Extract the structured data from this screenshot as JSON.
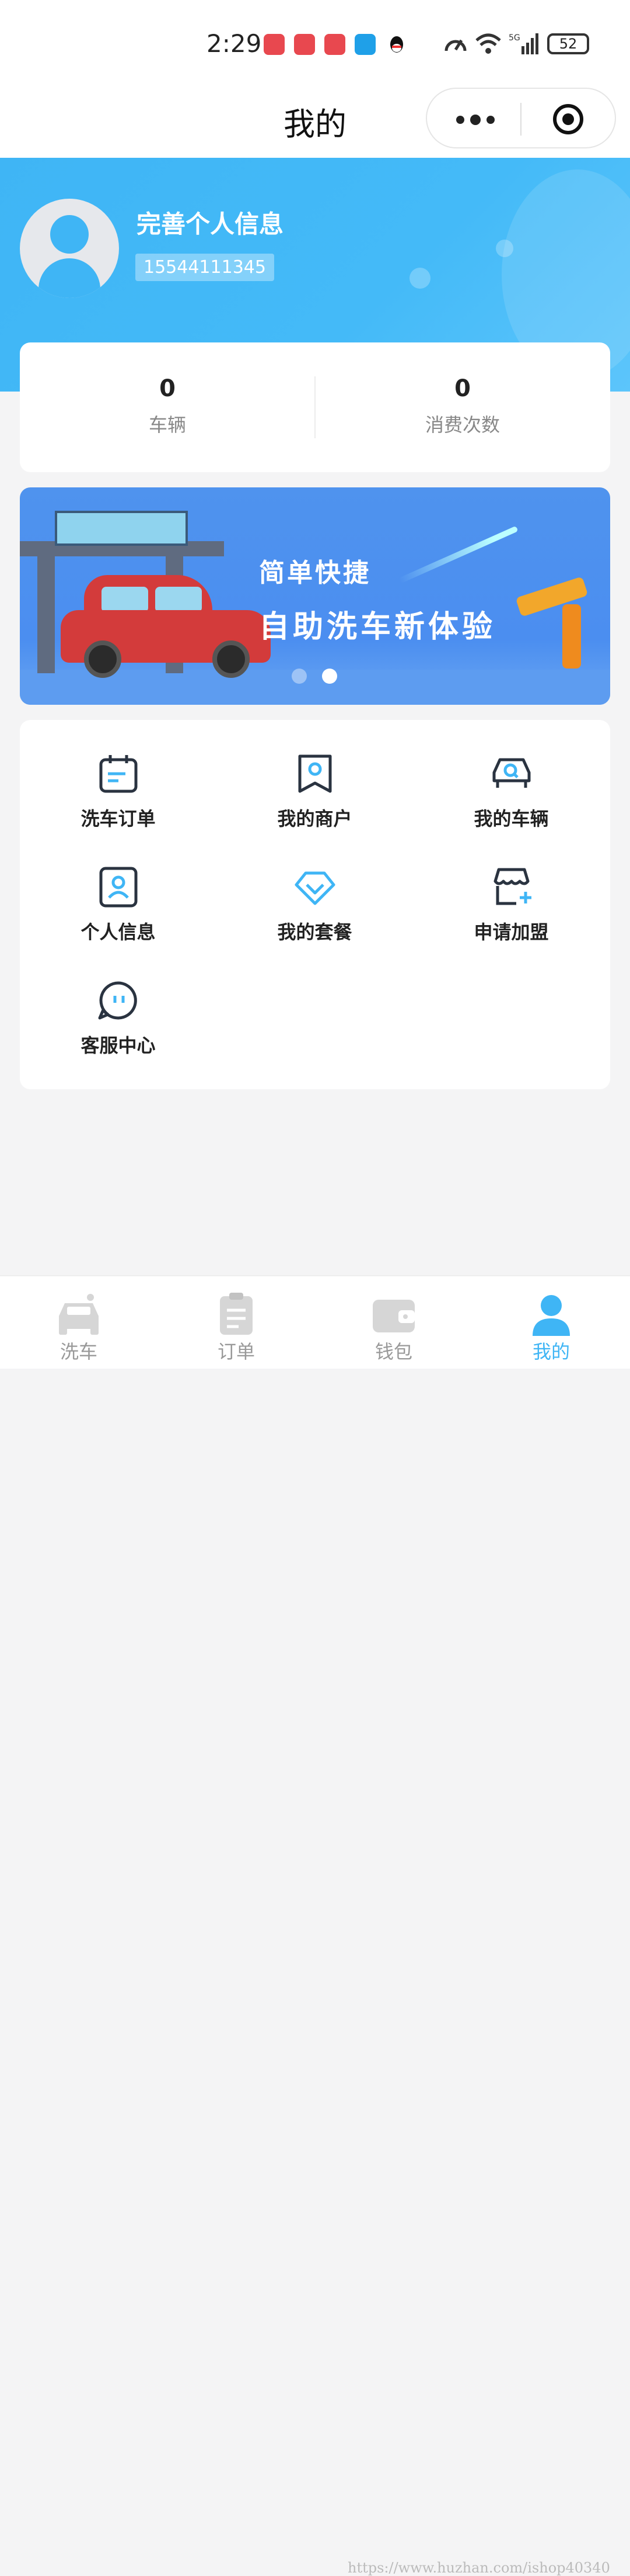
{
  "status_bar": {
    "time": "2:29",
    "battery": "52",
    "network": "5G"
  },
  "nav": {
    "title": "我的"
  },
  "profile": {
    "name": "完善个人信息",
    "phone": "15544111345"
  },
  "stats": [
    {
      "value": "0",
      "label": "车辆"
    },
    {
      "value": "0",
      "label": "消费次数"
    }
  ],
  "banner": {
    "slogan_small": "简单快捷",
    "slogan_big": "自助洗车新体验",
    "active_dot": 2,
    "dot_count": 2
  },
  "menu": [
    {
      "label": "洗车订单",
      "icon": "calendar-icon"
    },
    {
      "label": "我的商户",
      "icon": "merchant-bookmark-icon"
    },
    {
      "label": "我的车辆",
      "icon": "car-search-icon"
    },
    {
      "label": "个人信息",
      "icon": "person-card-icon"
    },
    {
      "label": "我的套餐",
      "icon": "diamond-icon"
    },
    {
      "label": "申请加盟",
      "icon": "store-add-icon"
    },
    {
      "label": "客服中心",
      "icon": "chat-bubble-icon"
    }
  ],
  "tabbar": [
    {
      "label": "洗车",
      "icon": "car-wash-icon",
      "active": false
    },
    {
      "label": "订单",
      "icon": "clipboard-icon",
      "active": false
    },
    {
      "label": "钱包",
      "icon": "wallet-icon",
      "active": false
    },
    {
      "label": "我的",
      "icon": "user-icon",
      "active": true
    }
  ],
  "watermark": "https://www.huzhan.com/ishop40340",
  "colors": {
    "accent": "#3fb5f5",
    "icon_dark": "#2a3340",
    "icon_blue": "#3fb5f5"
  }
}
